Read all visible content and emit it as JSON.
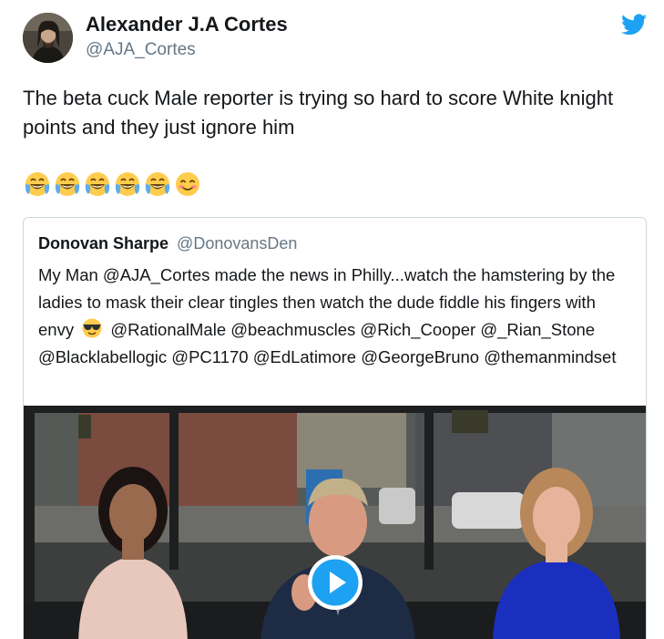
{
  "author": {
    "name": "Alexander J.A Cortes",
    "handle": "@AJA_Cortes",
    "avatar_icon": "user-avatar"
  },
  "brand": {
    "logo_icon": "twitter-bird-icon",
    "accent": "#1da1f2"
  },
  "tweet": {
    "text": "The beta cuck Male reporter is trying so hard to score White knight points and they just ignore him",
    "emojis": [
      "face-with-tears-of-joy",
      "face-with-tears-of-joy",
      "face-with-tears-of-joy",
      "face-with-tears-of-joy",
      "face-with-tears-of-joy",
      "smiling-face-with-smiling-eyes"
    ]
  },
  "quoted_tweet": {
    "name": "Donovan Sharpe",
    "handle": "@DonovansDen",
    "text_before_emoji": "My Man @AJA_Cortes made the news in Philly...watch the hamstering by the ladies to mask their clear tingles then watch the dude fiddle his fingers with envy",
    "inline_emoji": "smiling-face-with-sunglasses",
    "text_after_emoji": "@RationalMale @beachmuscles @Rich_Cooper @_Rian_Stone @Blacklabellogic @PC1170 @EdLatimore @GeorgeBruno @themanmindset",
    "video": {
      "play_icon": "play-icon"
    }
  },
  "colors": {
    "text": "#14171a",
    "secondary": "#657786",
    "border": "#ccd6dd",
    "play": "#1da1f2"
  }
}
